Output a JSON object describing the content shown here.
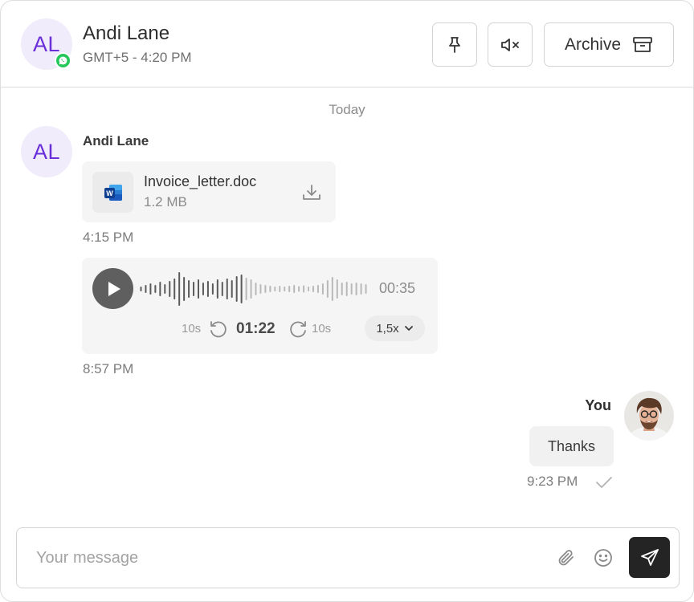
{
  "contact": {
    "initials": "AL",
    "name": "Andi Lane",
    "timezone_time": "GMT+5 - 4:20 PM",
    "channel_icon": "whatsapp-icon"
  },
  "header_actions": {
    "pin_icon": "pin-icon",
    "mute_icon": "mute-icon",
    "archive_label": "Archive",
    "archive_icon": "archive-box-icon"
  },
  "conversation": {
    "day_label": "Today",
    "incoming": {
      "sender_initials": "AL",
      "sender_name": "Andi Lane",
      "file": {
        "name": "Invoice_letter.doc",
        "size": "1.2 MB",
        "icon": "word-doc-icon"
      },
      "file_time": "4:15 PM",
      "voice": {
        "duration": "00:35",
        "current": "01:22",
        "skip_back": "10s",
        "skip_forward": "10s",
        "speed": "1,5x"
      },
      "voice_time": "8:57 PM"
    },
    "outgoing": {
      "sender_name": "You",
      "text": "Thanks",
      "time": "9:23 PM",
      "status": "sent"
    }
  },
  "composer": {
    "placeholder": "Your message",
    "value": ""
  },
  "colors": {
    "accent_purple": "#6a2fd9",
    "avatar_bg": "#f0ecfb",
    "whatsapp_green": "#25c65a",
    "send_button": "#242424"
  }
}
